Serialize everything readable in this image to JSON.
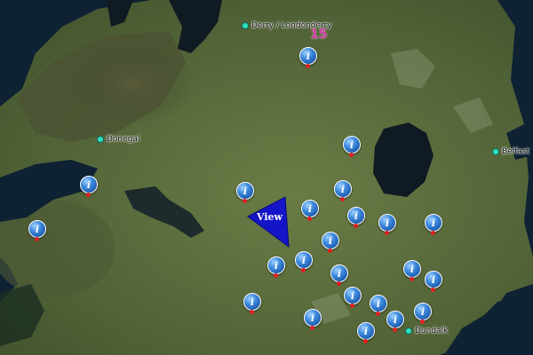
{
  "map": {
    "places": [
      {
        "name": "Derry / Londonderry",
        "id": "derry"
      },
      {
        "name": "Donegal",
        "id": "donegal"
      },
      {
        "name": "Belfast",
        "id": "belfast"
      },
      {
        "name": "Dundalk",
        "id": "dundalk"
      }
    ],
    "marker_count": "15",
    "marker_glyph": "i",
    "view_label": "View",
    "colors": {
      "sea": "#0e2233",
      "land": "#5b6d3f",
      "lake": "#0f1a22",
      "marker": "#2d77cf",
      "marker_foot": "#e02020",
      "place_dot": "#30e0c0",
      "view_cone": "#1414c8",
      "count_text": "#d83ea6"
    }
  },
  "markers": [
    {
      "id": "m1"
    },
    {
      "id": "m2"
    },
    {
      "id": "m3"
    },
    {
      "id": "m4"
    },
    {
      "id": "m5"
    },
    {
      "id": "m6"
    },
    {
      "id": "m7"
    },
    {
      "id": "m8"
    },
    {
      "id": "m9"
    },
    {
      "id": "m10"
    },
    {
      "id": "m11"
    },
    {
      "id": "m12"
    },
    {
      "id": "m13"
    },
    {
      "id": "m14"
    },
    {
      "id": "m15"
    },
    {
      "id": "m16"
    },
    {
      "id": "m17"
    },
    {
      "id": "m18"
    },
    {
      "id": "m19"
    },
    {
      "id": "m20"
    },
    {
      "id": "m21"
    },
    {
      "id": "m22"
    },
    {
      "id": "m23"
    },
    {
      "id": "m24"
    }
  ]
}
